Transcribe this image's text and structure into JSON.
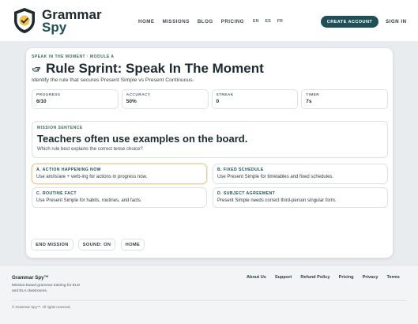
{
  "header": {
    "brand_line1": "Grammar",
    "brand_line2": "Spy",
    "nav": [
      "HOME",
      "MISSIONS",
      "BLOG",
      "PRICING"
    ],
    "languages": [
      "EN",
      "ES",
      "FR"
    ],
    "cta_label": "CREATE ACCOUNT",
    "signin_label": "SIGN IN"
  },
  "lesson": {
    "kicker": "SPEAK IN THE MOMENT · MODULE A",
    "title": "Rule Sprint: Speak In The Moment",
    "subtitle": "Identify the rule that secures Present Simple vs Present Continuous."
  },
  "stats": [
    {
      "label": "PROGRESS",
      "value": "6/10"
    },
    {
      "label": "ACCURACY",
      "value": "50%"
    },
    {
      "label": "STREAK",
      "value": "0"
    },
    {
      "label": "TIMER",
      "value": "7s"
    }
  ],
  "mission": {
    "label": "MISSION SENTENCE",
    "sentence": "Teachers often use examples on the board.",
    "question": "Which rule best explains the correct tense choice?"
  },
  "options": [
    {
      "label": "A. ACTION HAPPENING NOW",
      "desc": "Use am/is/are + verb-ing for actions in progress now."
    },
    {
      "label": "B. FIXED SCHEDULE",
      "desc": "Use Present Simple for timetables and fixed schedules."
    },
    {
      "label": "C. ROUTINE FACT",
      "desc": "Use Present Simple for habits, routines, and facts."
    },
    {
      "label": "D. SUBJECT AGREEMENT",
      "desc": "Present Simple needs correct third-person singular form."
    }
  ],
  "controls": {
    "end": "END MISSION",
    "sound": "SOUND: ON",
    "home": "HOME"
  },
  "footer": {
    "brand": "Grammar Spy™",
    "desc": "Mission-based grammar training for ELD and ELA classrooms.",
    "links": [
      "About Us",
      "Support",
      "Refund Policy",
      "Pricing",
      "Privacy",
      "Terms"
    ],
    "copyright": "© Grammar Spy™. All rights reserved."
  },
  "colors": {
    "accent": "#1f4f57",
    "selected_border": "#e7cf9a",
    "kicker": "#3d6b5c"
  },
  "icons": {
    "logo": "shield-check-logo",
    "title_icon": "hand-pointing-icon"
  }
}
